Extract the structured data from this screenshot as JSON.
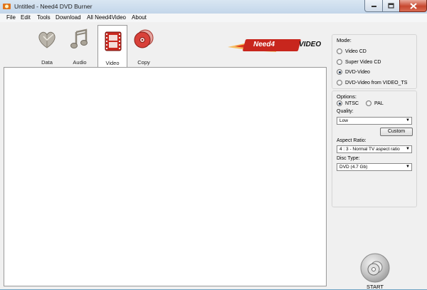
{
  "window": {
    "title": "Untitled - Need4 DVD Burner"
  },
  "menu": {
    "items": [
      {
        "label": "File"
      },
      {
        "label": "Edit"
      },
      {
        "label": "Tools"
      },
      {
        "label": "Download"
      },
      {
        "label": "All Need4Video"
      },
      {
        "label": "About"
      }
    ]
  },
  "tabs": [
    {
      "label": "Data",
      "icon": "data-heart-icon"
    },
    {
      "label": "Audio",
      "icon": "music-note-icon"
    },
    {
      "label": "Video",
      "icon": "film-reel-icon",
      "active": true
    },
    {
      "label": "Copy",
      "icon": "disc-copy-icon"
    }
  ],
  "logo": {
    "text_need4": "Need4",
    "text_video": "VIDEO"
  },
  "mode": {
    "title": "Mode:",
    "options": [
      {
        "label": "Video CD",
        "selected": false
      },
      {
        "label": "Super Video CD",
        "selected": false
      },
      {
        "label": "DVD-Video",
        "selected": true
      },
      {
        "label": "DVD-Video from VIDEO_TS",
        "selected": false
      }
    ]
  },
  "options": {
    "title": "Options:",
    "ntsc": "NTSC",
    "pal": "PAL",
    "ntsc_selected": true,
    "quality_label": "Quality:",
    "quality_value": "Low",
    "custom_button": "Custom",
    "aspect_label": "Aspect Ratio:",
    "aspect_value": "4 : 3 - Normal TV aspect ratio",
    "disc_label": "Disc Type:",
    "disc_value": "DVD (4.7 Gb)"
  },
  "start": {
    "label": "START"
  },
  "colors": {
    "accent_red": "#c8261d",
    "title_bar": "#c3d6ea",
    "close_button": "#c7472f"
  }
}
